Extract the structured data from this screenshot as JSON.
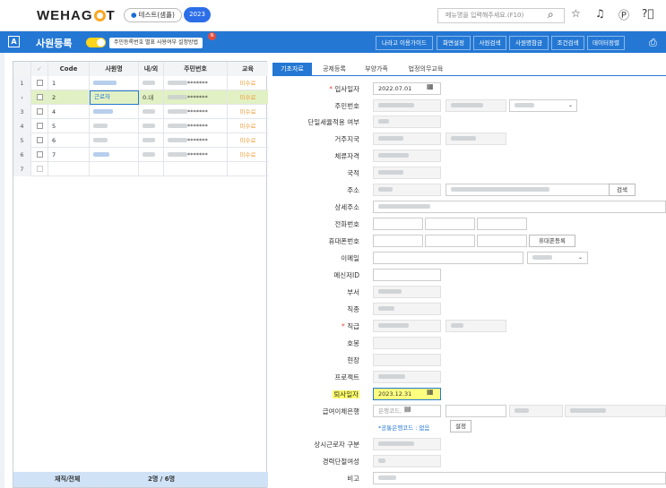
{
  "header": {
    "logo_pre": "WEHAG",
    "logo_post": "T",
    "company": "테스트(샘플)",
    "year": "2023",
    "search_placeholder": "메뉴명을 입력해주세요.(F10)",
    "icons": [
      "search-icon",
      "star-icon",
      "bell-icon",
      "p-icon",
      "help-icon"
    ]
  },
  "appbar": {
    "badge": "A",
    "title": "사원등록",
    "tooltip": "주민등록번호 별표 사용여부 설정방법",
    "new_badge": "N",
    "buttons": [
      "나라고 이용가이드",
      "화면설정",
      "사원검색",
      "사원명참금",
      "조건검색",
      "데이터정렬"
    ]
  },
  "grid": {
    "columns": [
      "",
      "✓",
      "Code",
      "사원명",
      "내/외",
      "주민번호",
      "교육"
    ],
    "rows": [
      {
        "num": "1",
        "code": "1",
        "name": "",
        "nw": "",
        "rrn": "*******",
        "edu": "미수료"
      },
      {
        "num": "2",
        "code": "2",
        "name": "근로자",
        "nw": "0.내",
        "rrn": "*******",
        "edu": "미수료"
      },
      {
        "num": "3",
        "code": "4",
        "name": "",
        "nw": "",
        "rrn": "*******",
        "edu": "미수료"
      },
      {
        "num": "4",
        "code": "5",
        "name": "",
        "nw": "",
        "rrn": "*******",
        "edu": "미수료"
      },
      {
        "num": "5",
        "code": "6",
        "name": "",
        "nw": "",
        "rrn": "*******",
        "edu": "미수료"
      },
      {
        "num": "6",
        "code": "7",
        "name": "",
        "nw": "",
        "rrn": "*******",
        "edu": "미수료"
      },
      {
        "num": "7",
        "code": "",
        "name": "",
        "nw": "",
        "rrn": "",
        "edu": ""
      }
    ],
    "selected_marker": "›",
    "footer_label": "재직/전체",
    "footer_value": "2명 / 6명"
  },
  "tabs": [
    "기초자료",
    "공제등록",
    "부양가족",
    "법정의무교육"
  ],
  "form": {
    "labels": {
      "hire_date": "입사일자",
      "rrn": "주민번호",
      "single_tax": "단일세율적용 여부",
      "residence": "거주지국",
      "stay_status": "체류자격",
      "nationality": "국적",
      "address": "주소",
      "address_detail": "상세주소",
      "phone": "전화번호",
      "mobile": "휴대폰번호",
      "email": "이메일",
      "messenger": "메신저ID",
      "department": "부서",
      "job_type": "직종",
      "position": "직급",
      "grade": "호봉",
      "site": "현장",
      "project": "프로젝트",
      "resign_date": "퇴사일자",
      "bank": "급여이체은행",
      "regular_type": "상시근로자 구분",
      "career_break": "경력단절여성",
      "remarks": "비고"
    },
    "hire_date_value": "2022.07.01",
    "resign_date_value": "2023.12.31",
    "bank_placeholder": "은행코드, ...",
    "bank_link": "*공통은행코드 : 없음",
    "buttons": {
      "address_search": "검색",
      "mobile_register": "휴대폰등록",
      "bank_settings": "설정"
    }
  }
}
